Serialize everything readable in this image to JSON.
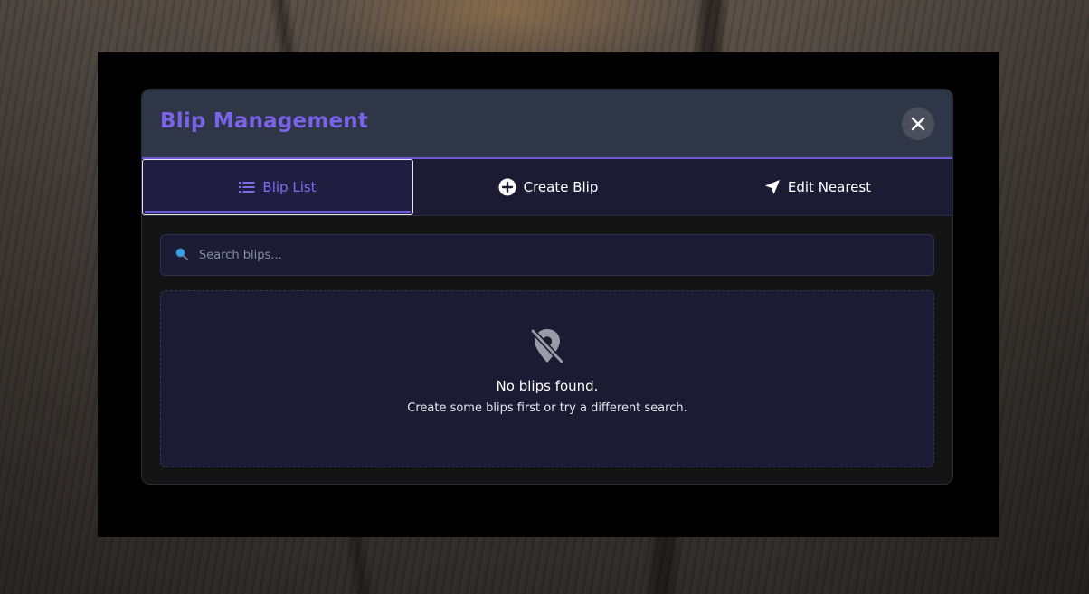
{
  "modal": {
    "title": "Blip Management",
    "close_icon": "close-icon"
  },
  "tabs": [
    {
      "label": "Blip List",
      "icon": "list-icon",
      "active": true
    },
    {
      "label": "Create Blip",
      "icon": "plus-circle-icon",
      "active": false
    },
    {
      "label": "Edit Nearest",
      "icon": "location-arrow-icon",
      "active": false
    }
  ],
  "search": {
    "placeholder": "Search blips...",
    "value": "",
    "icon": "search-icon"
  },
  "empty_state": {
    "icon": "map-marker-slash-icon",
    "title": "No blips found.",
    "subtitle": "Create some blips first or try a different search."
  },
  "colors": {
    "accent": "#7058e0",
    "header_bg": "#2e3648",
    "panel_bg": "#1b1c33"
  }
}
